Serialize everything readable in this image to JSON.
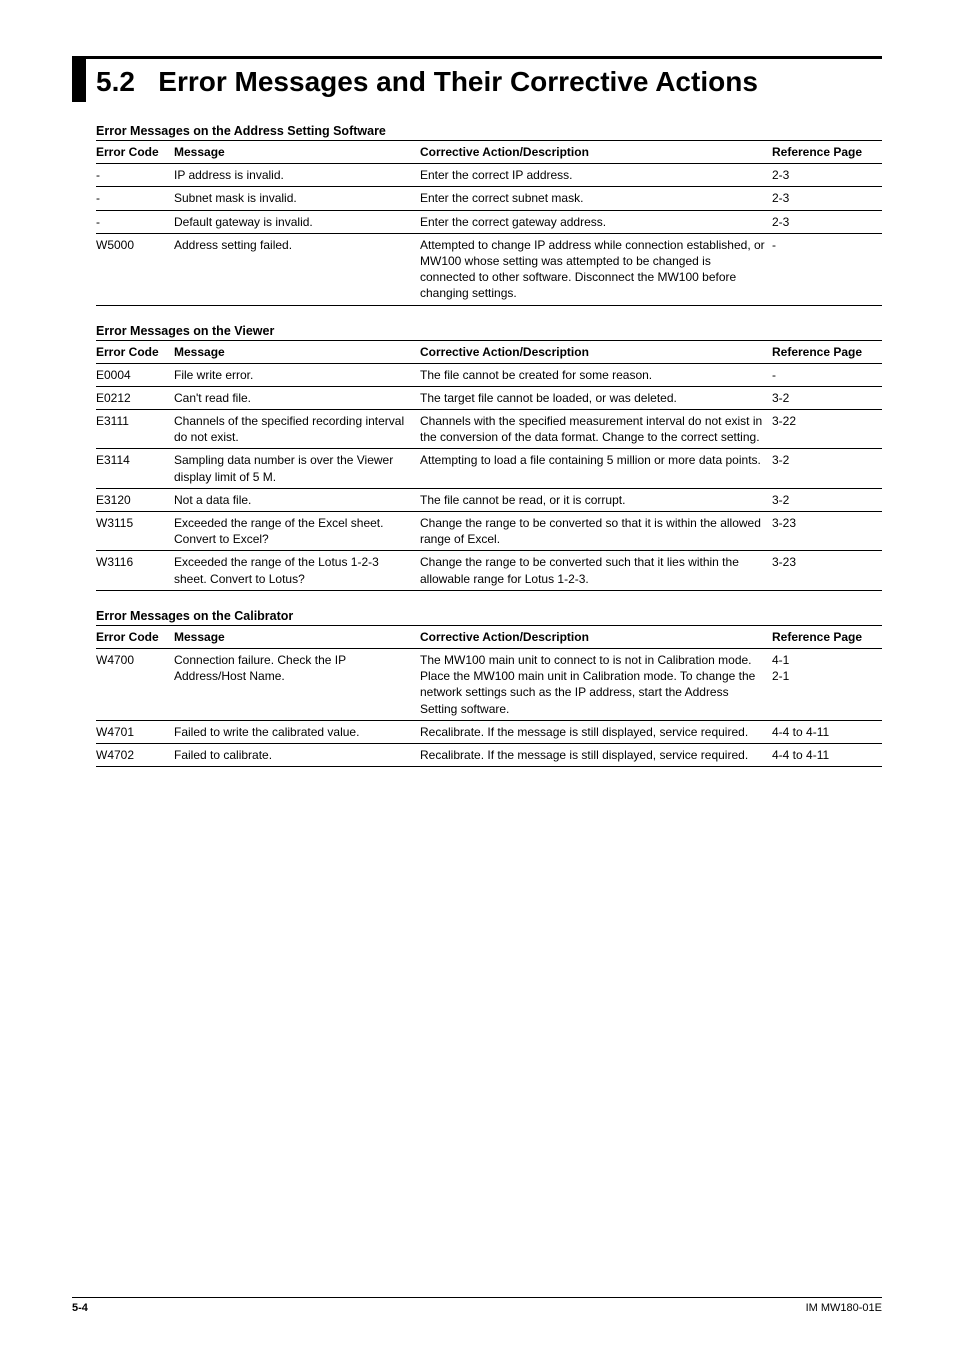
{
  "section_number": "5.2",
  "section_title": "Error Messages and Their Corrective Actions",
  "tables": [
    {
      "name": "address-setting",
      "heading": "Error Messages on the Address Setting Software",
      "columns": [
        "Error Code",
        "Message",
        "Corrective Action/Description",
        "Reference Page"
      ],
      "rows": [
        {
          "code": "-",
          "msg": "IP address is invalid.",
          "corr": "Enter the correct IP address.",
          "ref": "2-3"
        },
        {
          "code": "-",
          "msg": "Subnet mask is invalid.",
          "corr": "Enter the correct subnet mask.",
          "ref": "2-3"
        },
        {
          "code": "-",
          "msg": "Default gateway is invalid.",
          "corr": "Enter the correct gateway address.",
          "ref": "2-3"
        },
        {
          "code": "W5000",
          "msg": "Address setting failed.",
          "corr": "Attempted to change IP address while connection established, or MW100 whose setting was attempted to be changed is connected to other software. Disconnect the MW100 before changing settings.",
          "ref": "-"
        }
      ]
    },
    {
      "name": "viewer",
      "heading": "Error Messages on the Viewer",
      "columns": [
        "Error Code",
        "Message",
        "Corrective Action/Description",
        "Reference Page"
      ],
      "rows": [
        {
          "code": "E0004",
          "msg": "File write error.",
          "corr": "The file cannot be created for some reason.",
          "ref": "-"
        },
        {
          "code": "E0212",
          "msg": "Can't read file.",
          "corr": "The target file cannot be loaded, or was deleted.",
          "ref": "3-2"
        },
        {
          "code": "E3111",
          "msg": "Channels of the specified recording interval do not exist.",
          "corr": "Channels with the specified measurement interval do not exist in the conversion of the data format. Change to the correct setting.",
          "ref": "3-22"
        },
        {
          "code": "E3114",
          "msg": "Sampling data number is over the Viewer display limit of 5 M.",
          "corr": "Attempting to load a file containing 5 million or more data points.",
          "ref": "3-2"
        },
        {
          "code": "E3120",
          "msg": "Not a data file.",
          "corr": "The file cannot be read, or it is corrupt.",
          "ref": "3-2"
        },
        {
          "code": "W3115",
          "msg": "Exceeded the range of the Excel sheet. Convert to Excel?",
          "corr": "Change the range to be converted so that it is within the allowed range of Excel.",
          "ref": "3-23"
        },
        {
          "code": "W3116",
          "msg": "Exceeded the range of the Lotus 1-2-3 sheet. Convert to Lotus?",
          "corr": "Change the range to be converted such that it lies within the allowable range for Lotus 1-2-3.",
          "ref": "3-23"
        }
      ]
    },
    {
      "name": "calibrator",
      "heading": "Error Messages on the Calibrator",
      "columns": [
        "Error Code",
        "Message",
        "Corrective Action/Description",
        "Reference Page"
      ],
      "rows": [
        {
          "code": "W4700",
          "msg": "Connection failure. Check the IP Address/Host Name.",
          "corr": "The MW100 main unit to connect to is not in Calibration mode. Place the MW100 main unit in Calibration mode. To change the network settings such as the IP address, start the Address Setting software.",
          "ref": "4-1\n2-1"
        },
        {
          "code": "W4701",
          "msg": "Failed to write the calibrated value.",
          "corr": "Recalibrate. If the message is still displayed, service required.",
          "ref": "4-4 to 4-11"
        },
        {
          "code": "W4702",
          "msg": "Failed to calibrate.",
          "corr": "Recalibrate. If the message is still displayed, service required.",
          "ref": "4-4 to 4-11"
        }
      ]
    }
  ],
  "footer": {
    "page": "5-4",
    "doc": "IM MW180-01E"
  }
}
